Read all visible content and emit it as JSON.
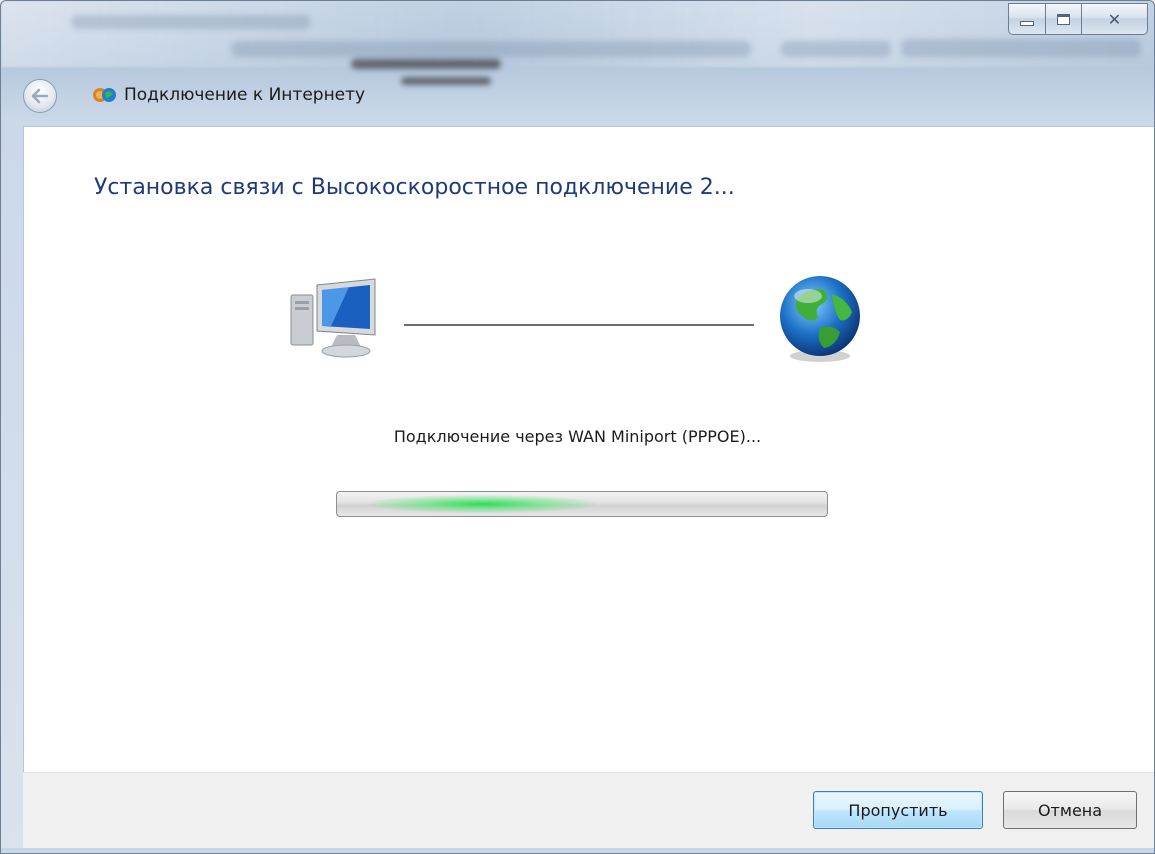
{
  "window": {
    "title": "Подключение к Интернету",
    "caption": {
      "close_glyph": "✕"
    }
  },
  "wizard": {
    "heading": "Установка связи с Высокоскоростное подключение 2...",
    "status_text": "Подключение через WAN Miniport (PPPOE)...",
    "progress": {
      "mode": "indeterminate",
      "accent": "#2fd35a"
    }
  },
  "footer": {
    "skip_label": "Пропустить",
    "cancel_label": "Отмена"
  },
  "icons": {
    "back": "back-arrow-icon",
    "app": "network-connection-icon",
    "computer": "computer-icon",
    "globe": "globe-icon"
  },
  "colors": {
    "heading": "#1e3a78",
    "skip_button_border": "#3c7fb1"
  }
}
